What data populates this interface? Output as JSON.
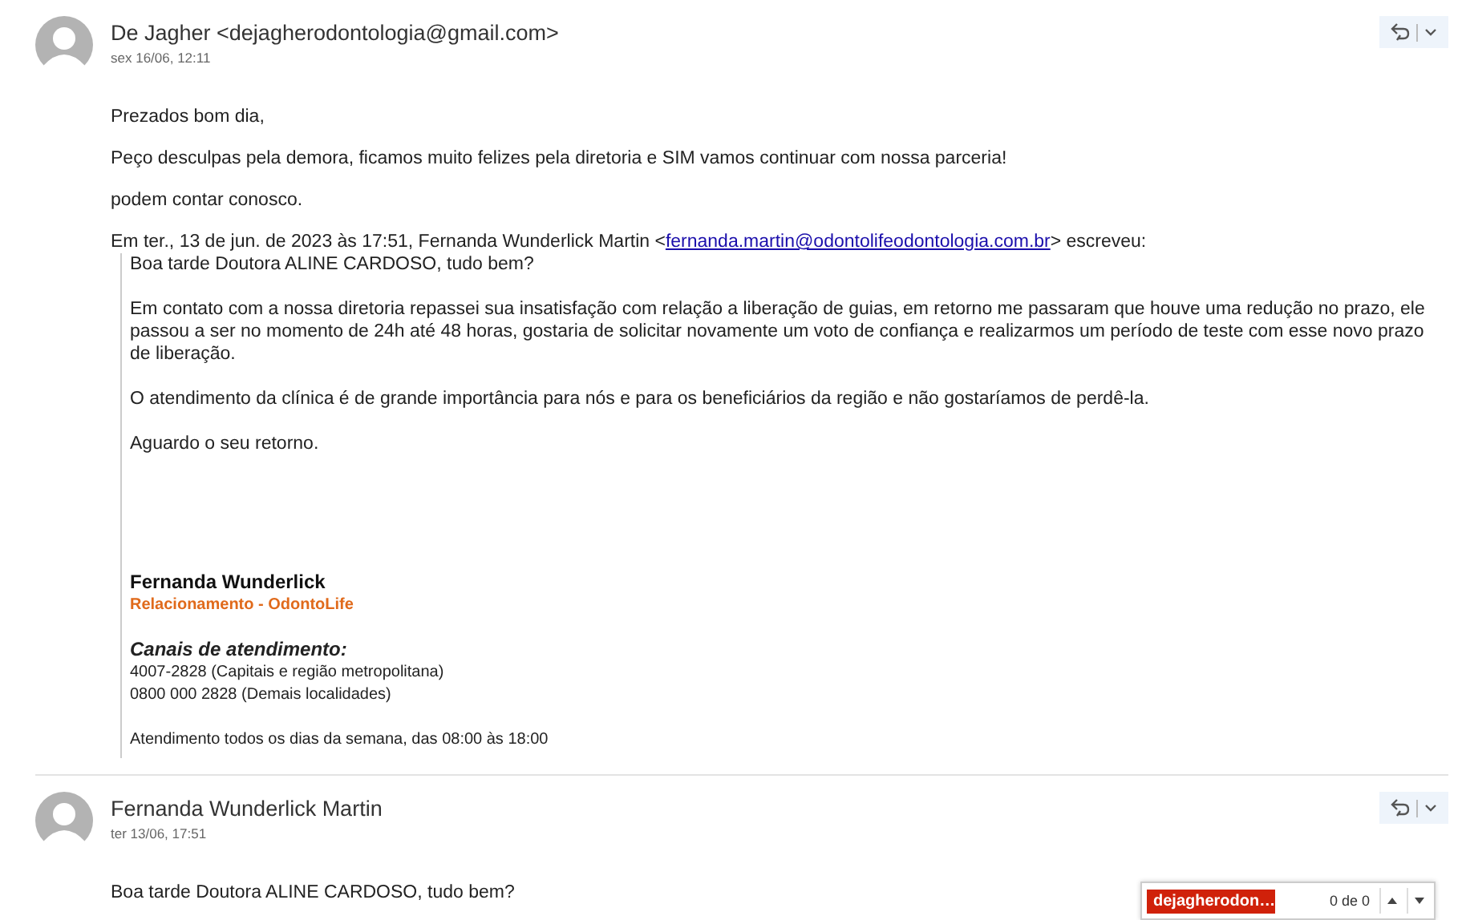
{
  "messages": [
    {
      "sender": "De Jagher <dejagherodontologia@gmail.com>",
      "date": "sex 16/06, 12:11",
      "body": [
        "Prezados bom dia,",
        "Peço desculpas pela demora, ficamos muito felizes pela diretoria e SIM vamos continuar com nossa parceria!",
        "podem contar conosco."
      ],
      "quote": {
        "intro": "Em ter., 13 de jun. de 2023 às 17:51, Fernanda Wunderlick Martin <",
        "link": "fernanda.martin@odontolifeodontologia.com.br",
        "outro": "> escreveu:",
        "paragraphs": [
          "Boa tarde Doutora ALINE CARDOSO, tudo bem?",
          "Em contato com a nossa diretoria repassei sua insatisfação com relação a liberação de guias, em retorno me passaram que houve uma redução no prazo, ele passou a ser no momento de 24h até 48 horas, gostaria de solicitar novamente um voto de confiança e realizarmos um período de teste com esse novo prazo de liberação.",
          "O atendimento da clínica é de grande importância para nós e para os beneficiários da região e não gostaríamos de perdê-la.",
          "Aguardo o seu retorno."
        ],
        "signature": {
          "name": "Fernanda Wunderlick",
          "role": "Relacionamento - OdontoLife",
          "channels_title": "Canais de atendimento:",
          "phones": [
            "4007-2828 (Capitais e região metropolitana)",
            "0800 000 2828 (Demais localidades)"
          ],
          "hours": "Atendimento todos os dias da semana, das 08:00 às 18:00"
        }
      }
    },
    {
      "sender": "Fernanda Wunderlick Martin",
      "date": "ter 13/06, 17:51",
      "body": [
        "Boa tarde Doutora ALINE CARDOSO, tudo bem?"
      ]
    }
  ],
  "find_bar": {
    "query": "dejagherodon…",
    "count": "0 de 0"
  }
}
